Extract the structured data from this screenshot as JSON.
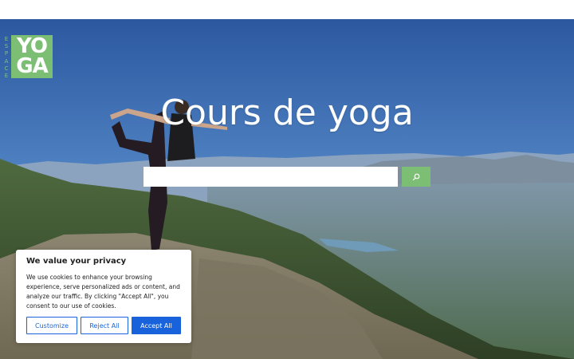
{
  "logo": {
    "vertical_letters": [
      "E",
      "S",
      "P",
      "A",
      "C",
      "E"
    ],
    "line1": "YO",
    "line2": "GA"
  },
  "hero": {
    "title": "Cours de yoga"
  },
  "search": {
    "value": "",
    "button_icon": "search-icon"
  },
  "cookie_banner": {
    "title": "We value your privacy",
    "text": "We use cookies to enhance your browsing experience, serve personalized ads or content, and analyze our traffic. By clicking \"Accept All\", you consent to our use of cookies.",
    "customize_label": "Customize",
    "reject_label": "Reject All",
    "accept_label": "Accept All"
  },
  "colors": {
    "brand_green": "#7cbf74",
    "consent_blue": "#1863dc"
  }
}
